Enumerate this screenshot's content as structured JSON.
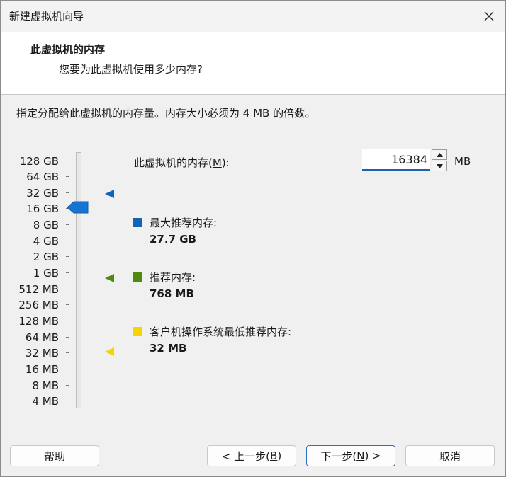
{
  "window": {
    "title": "新建虚拟机向导"
  },
  "header": {
    "title": "此虚拟机的内存",
    "subtitle": "您要为此虚拟机使用多少内存?"
  },
  "description": "指定分配给此虚拟机的内存量。内存大小必须为 4 MB 的倍数。",
  "memory": {
    "label_prefix": "此虚拟机的内存(",
    "label_mnemonic": "M",
    "label_suffix": "):",
    "value": "16384",
    "unit": "MB"
  },
  "scale_labels": [
    "128 GB",
    "64 GB",
    "32 GB",
    "16 GB",
    "8 GB",
    "4 GB",
    "2 GB",
    "1 GB",
    "512 MB",
    "256 MB",
    "128 MB",
    "64 MB",
    "32 MB",
    "16 MB",
    "8 MB",
    "4 MB"
  ],
  "slider": {
    "selected": "16 GB"
  },
  "legend": [
    {
      "label": "最大推荐内存:",
      "value": "27.7 GB",
      "color": "#0f64b4"
    },
    {
      "label": "推荐内存:",
      "value": "768 MB",
      "color": "#4f8a10"
    },
    {
      "label": "客户机操作系统最低推荐内存:",
      "value": "32 MB",
      "color": "#f5d400"
    }
  ],
  "buttons": {
    "help": "帮助",
    "back_prefix": "< 上一步(",
    "back_mnemonic": "B",
    "back_suffix": ")",
    "next_prefix": "下一步(",
    "next_mnemonic": "N",
    "next_suffix": ") >",
    "cancel": "取消"
  }
}
